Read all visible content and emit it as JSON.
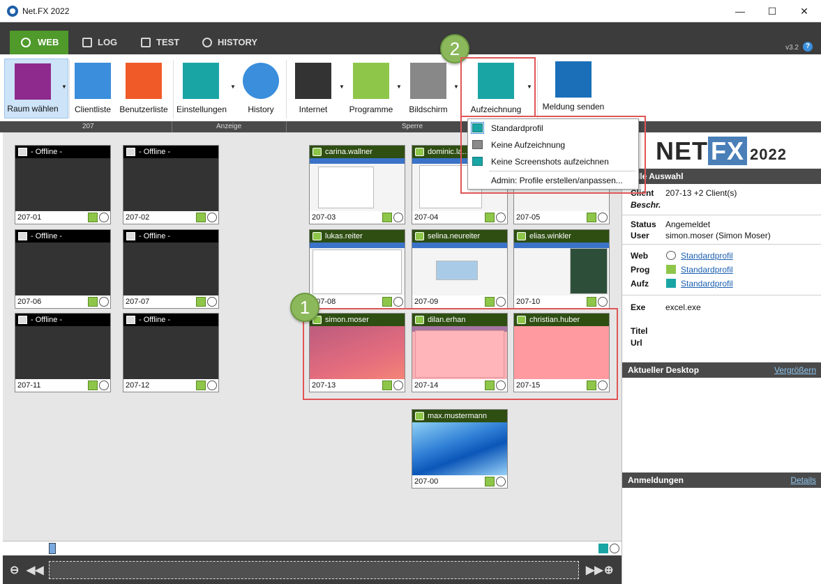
{
  "window": {
    "title": "Net.FX 2022",
    "minimize": "—",
    "maximize": "☐",
    "close": "✕"
  },
  "tabs": [
    {
      "label": "WEB",
      "active": true
    },
    {
      "label": "LOG"
    },
    {
      "label": "TEST"
    },
    {
      "label": "HISTORY"
    }
  ],
  "version": "v3.2",
  "help": "?",
  "ribbon": {
    "buttons": [
      {
        "label": "Raum wählen",
        "color": "#8e2a8e"
      },
      {
        "label": "Clientliste",
        "color": "#3a8edb"
      },
      {
        "label": "Benutzerliste",
        "color": "#f05a28"
      },
      {
        "label": "Einstellungen",
        "color": "#1aa5a5"
      },
      {
        "label": "History",
        "color": "#3a8edb"
      },
      {
        "label": "Internet",
        "color": "#333333"
      },
      {
        "label": "Programme",
        "color": "#8ec64a"
      },
      {
        "label": "Bildschirm",
        "color": "#888888"
      },
      {
        "label": "Aufzeichnung",
        "color": "#1aa5a5"
      },
      {
        "label": "Meldung senden",
        "color": "#1a6fb8"
      }
    ],
    "groups": [
      "207",
      "Anzeige",
      "Sperre"
    ]
  },
  "menu": {
    "items": [
      "Standardprofil",
      "Keine Aufzeichnung",
      "Keine Screenshots aufzeichnen",
      "Admin: Profile erstellen/anpassen..."
    ]
  },
  "annotations": [
    "1",
    "2"
  ],
  "clients": [
    {
      "user": "- Offline -",
      "id": "207-01"
    },
    {
      "user": "- Offline -",
      "id": "207-02"
    },
    {
      "user": "- Offline -",
      "id": "207-06"
    },
    {
      "user": "- Offline -",
      "id": "207-07"
    },
    {
      "user": "- Offline -",
      "id": "207-11"
    },
    {
      "user": "- Offline -",
      "id": "207-12"
    },
    {
      "user": "carina.wallner",
      "id": "207-03"
    },
    {
      "user": "dominic.la...",
      "id": "207-04"
    },
    {
      "user": "",
      "id": "207-05"
    },
    {
      "user": "lukas.reiter",
      "id": "207-08"
    },
    {
      "user": "selina.neureiter",
      "id": "207-09"
    },
    {
      "user": "elias.winkler",
      "id": "207-10"
    },
    {
      "user": "simon.moser",
      "id": "207-13"
    },
    {
      "user": "dilan.erhan",
      "id": "207-14"
    },
    {
      "user": "christian.huber",
      "id": "207-15"
    },
    {
      "user": "max.mustermann",
      "id": "207-00"
    }
  ],
  "panel": {
    "logo_net": "NET",
    "logo_fx": "FX",
    "logo_year": "2022",
    "selection_header": "uelle Auswahl",
    "client_label": "Client",
    "client_value": "207-13 +2 Client(s)",
    "beschr_label": "Beschr.",
    "status_label": "Status",
    "status_value": "Angemeldet",
    "user_label": "User",
    "user_value": "simon.moser (Simon Moser)",
    "web_label": "Web",
    "web_value": "Standardprofil",
    "prog_label": "Prog",
    "prog_value": "Standardprofil",
    "aufz_label": "Aufz",
    "aufz_value": "Standardprofil",
    "exe_label": "Exe",
    "exe_value": "excel.exe",
    "titel_label": "Titel",
    "url_label": "Url",
    "desktop_header": "Aktueller Desktop",
    "desktop_link": "Vergrößern",
    "logins_header": "Anmeldungen",
    "logins_link": "Details"
  },
  "timeline": {
    "zoom_out": "⊖",
    "rewind": "◀◀",
    "forward": "▶▶",
    "zoom_in": "⊕"
  }
}
